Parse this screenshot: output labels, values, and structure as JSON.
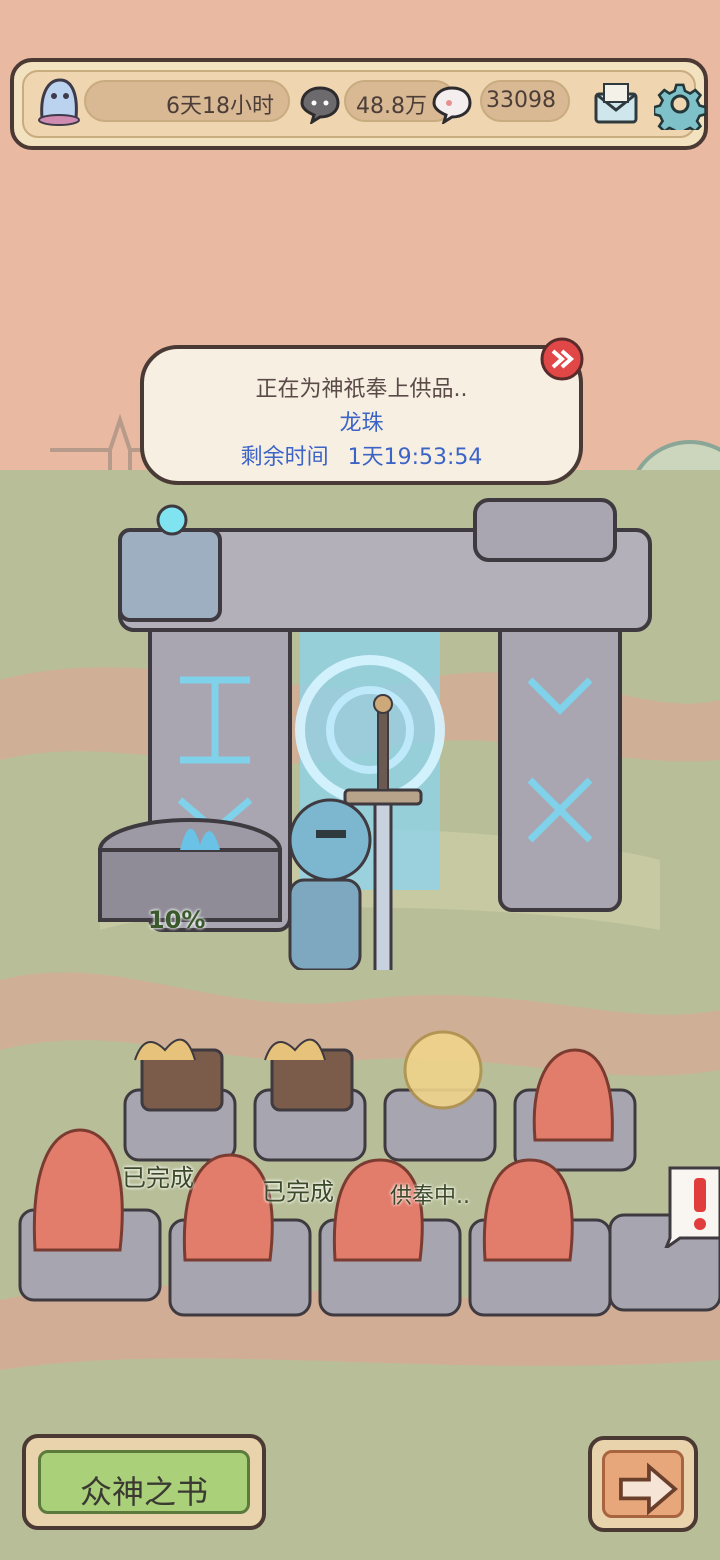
{
  "hud": {
    "ghost_timer": "6天18小时",
    "dark_bubble_count": "48.8万",
    "light_bubble_count": "33098",
    "icons": [
      "ghost-icon",
      "dark-bubble-icon",
      "light-bubble-icon",
      "mail-icon",
      "gear-icon"
    ]
  },
  "offering": {
    "line1": "正在为神祇奉上供品..",
    "item": "龙珠",
    "time_label": "剩余时间",
    "time_value": "1天19:53:54"
  },
  "altar": {
    "progress_label": "10%"
  },
  "slots": {
    "slot1_status": "已完成",
    "slot2_status": "已完成",
    "slot3_status": "供奉中.."
  },
  "buttons": {
    "gods_book": "众神之书",
    "next_icon": "arrow-right-icon"
  },
  "colors": {
    "accent_blue": "#3c64c6",
    "hud_bg": "#efd6b0",
    "button_green": "#aad07a"
  }
}
